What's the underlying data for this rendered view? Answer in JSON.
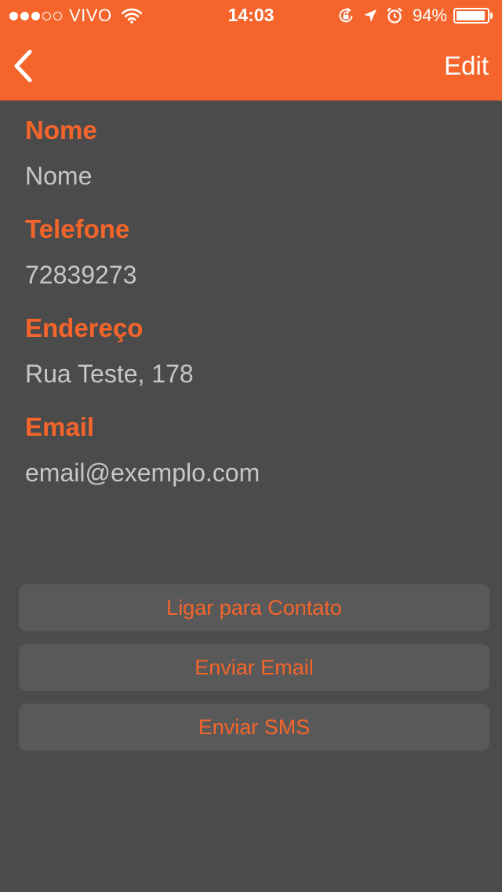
{
  "status_bar": {
    "signal_dots_filled": 3,
    "signal_dots_total": 5,
    "carrier": "VIVO",
    "time": "14:03",
    "battery_percent_label": "94%",
    "battery_level": 0.94,
    "icons": [
      "wifi-icon",
      "orientation-lock-icon",
      "location-arrow-icon",
      "alarm-icon",
      "battery-icon"
    ]
  },
  "nav": {
    "back_icon": "chevron-left-icon",
    "edit_label": "Edit"
  },
  "fields": [
    {
      "label": "Nome",
      "value": "Nome"
    },
    {
      "label": "Telefone",
      "value": "72839273"
    },
    {
      "label": "Endereço",
      "value": "Rua Teste, 178"
    },
    {
      "label": "Email",
      "value": "email@exemplo.com"
    }
  ],
  "actions": [
    {
      "label": "Ligar para Contato"
    },
    {
      "label": "Enviar Email"
    },
    {
      "label": "Enviar SMS"
    }
  ],
  "colors": {
    "accent": "#f5652b",
    "background": "#4b4b4b",
    "button_background": "#595959",
    "value_text": "#c7c7c7"
  }
}
